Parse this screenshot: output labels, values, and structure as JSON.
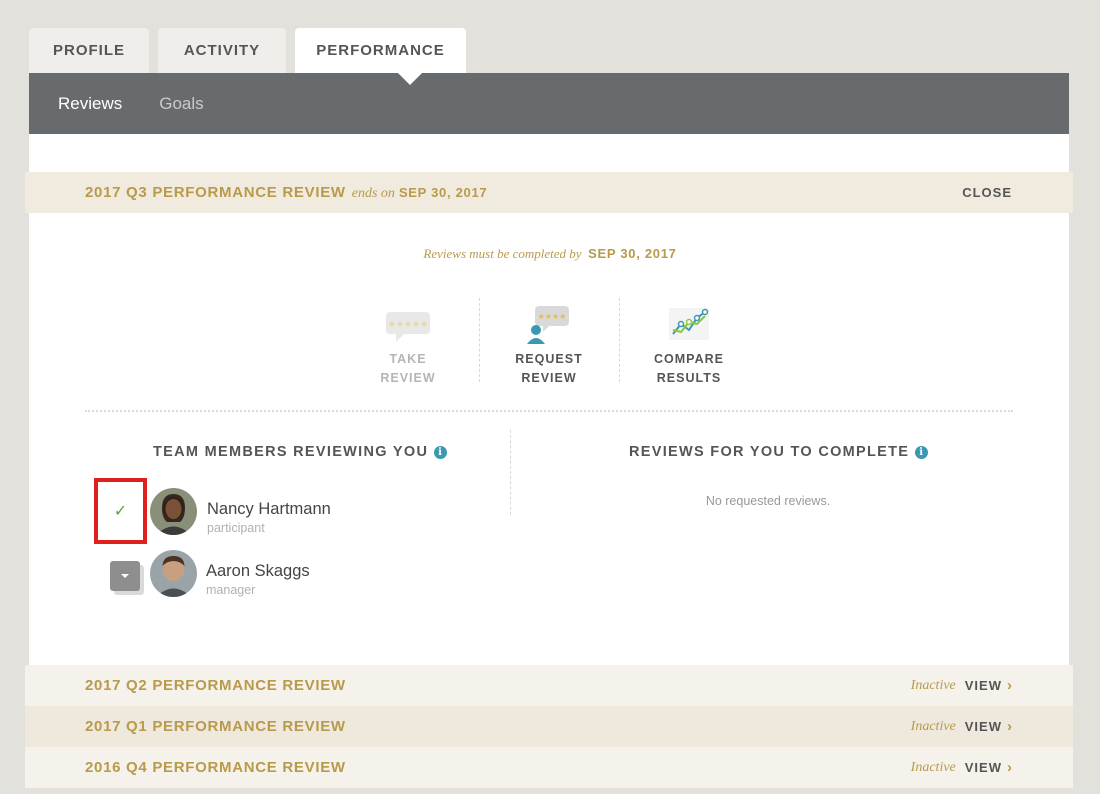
{
  "tabs": [
    {
      "label": "PROFILE"
    },
    {
      "label": "ACTIVITY"
    },
    {
      "label": "PERFORMANCE"
    }
  ],
  "subnav": {
    "items": [
      {
        "label": "Reviews",
        "active": true
      },
      {
        "label": "Goals",
        "active": false
      }
    ]
  },
  "current_review": {
    "title": "2017 Q3 PERFORMANCE REVIEW",
    "ends_label": "ends on",
    "ends_date": "SEP 30, 2017",
    "close_label": "CLOSE",
    "deadline_lead": "Reviews must be completed by",
    "deadline_date": "SEP 30, 2017"
  },
  "actions": [
    {
      "line1": "TAKE",
      "line2": "REVIEW",
      "disabled": true,
      "icon": "speech-bubble-stars-icon"
    },
    {
      "line1": "REQUEST",
      "line2": "REVIEW",
      "disabled": false,
      "icon": "person-stars-icon"
    },
    {
      "line1": "COMPARE",
      "line2": "RESULTS",
      "disabled": false,
      "icon": "line-graph-icon"
    }
  ],
  "team_members": {
    "title": "TEAM MEMBERS REVIEWING YOU",
    "info": "i",
    "members": [
      {
        "name": "Nancy Hartmann",
        "role": "participant",
        "status": "completed"
      },
      {
        "name": "Aaron Skaggs",
        "role": "manager",
        "status": "pending"
      }
    ]
  },
  "to_complete": {
    "title": "REVIEWS FOR YOU TO COMPLETE",
    "info": "i",
    "empty_text": "No requested reviews."
  },
  "past_reviews": [
    {
      "title": "2017 Q2 PERFORMANCE REVIEW",
      "status": "Inactive",
      "action": "VIEW"
    },
    {
      "title": "2017 Q1 PERFORMANCE REVIEW",
      "status": "Inactive",
      "action": "VIEW"
    },
    {
      "title": "2016 Q4 PERFORMANCE REVIEW",
      "status": "Inactive",
      "action": "VIEW"
    }
  ],
  "colors": {
    "accent_gold": "#b89a4a",
    "subnav_bg": "#686b6e",
    "check_green": "#5aa33a",
    "highlight_red": "#e0201c",
    "info_blue": "#3a98b0"
  }
}
